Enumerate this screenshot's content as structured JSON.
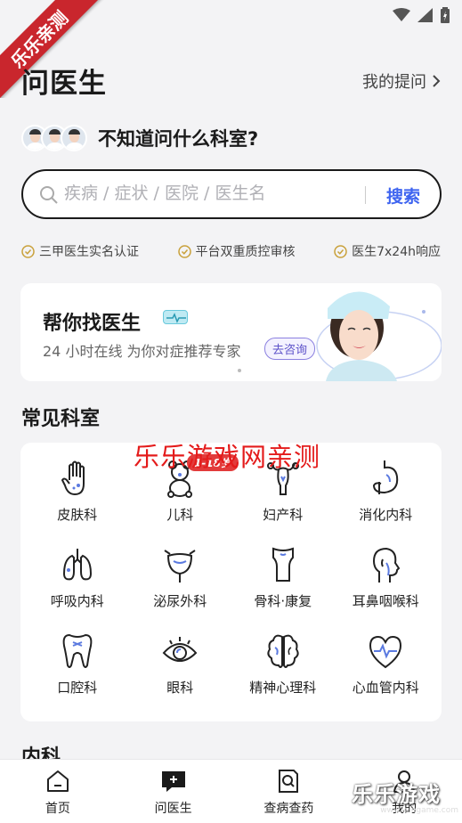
{
  "ribbon": {
    "text": "乐乐亲测"
  },
  "header": {
    "title": "问医生",
    "my_questions": "我的提问"
  },
  "prompt": {
    "text": "不知道问什么科室?"
  },
  "search": {
    "placeholder": "疾病 / 症状 / 医院 / 医生名",
    "button": "搜索"
  },
  "features": [
    {
      "icon": "check-circle-icon",
      "label": "三甲医生实名认证"
    },
    {
      "icon": "check-circle-icon",
      "label": "平台双重质控审核"
    },
    {
      "icon": "check-circle-icon",
      "label": "医生7x24h响应"
    }
  ],
  "banner": {
    "title": "帮你找医生",
    "subtitle": "24 小时在线 为你对症推荐专家",
    "button": "去咨询"
  },
  "common_departments": {
    "title": "常见科室",
    "age_tag": "1-18岁",
    "items": [
      {
        "label": "皮肤科",
        "icon": "hand-icon"
      },
      {
        "label": "儿科",
        "icon": "teddy-bear-icon"
      },
      {
        "label": "妇产科",
        "icon": "uterus-icon"
      },
      {
        "label": "消化内科",
        "icon": "stomach-icon"
      },
      {
        "label": "呼吸内科",
        "icon": "lungs-icon"
      },
      {
        "label": "泌尿外科",
        "icon": "bladder-icon"
      },
      {
        "label": "骨科·康复",
        "icon": "bone-icon"
      },
      {
        "label": "耳鼻咽喉科",
        "icon": "head-profile-icon"
      },
      {
        "label": "口腔科",
        "icon": "tooth-icon"
      },
      {
        "label": "眼科",
        "icon": "eye-icon"
      },
      {
        "label": "精神心理科",
        "icon": "brain-icon"
      },
      {
        "label": "心血管内科",
        "icon": "heart-pulse-icon"
      }
    ]
  },
  "next_section": {
    "title": "内科"
  },
  "watermark": {
    "center": "乐乐游戏网亲测",
    "corner": "乐乐游戏",
    "corner_url": "www.lelegame.com"
  },
  "tabbar": [
    {
      "label": "首页",
      "icon": "home-icon"
    },
    {
      "label": "问医生",
      "icon": "chat-plus-icon"
    },
    {
      "label": "查病查药",
      "icon": "doc-search-icon"
    },
    {
      "label": "我的",
      "icon": "person-icon"
    }
  ],
  "colors": {
    "accent": "#3e64f0",
    "gold": "#c9a13b",
    "ribbon": "#c9262d",
    "banner_button": "#5d52c9"
  }
}
